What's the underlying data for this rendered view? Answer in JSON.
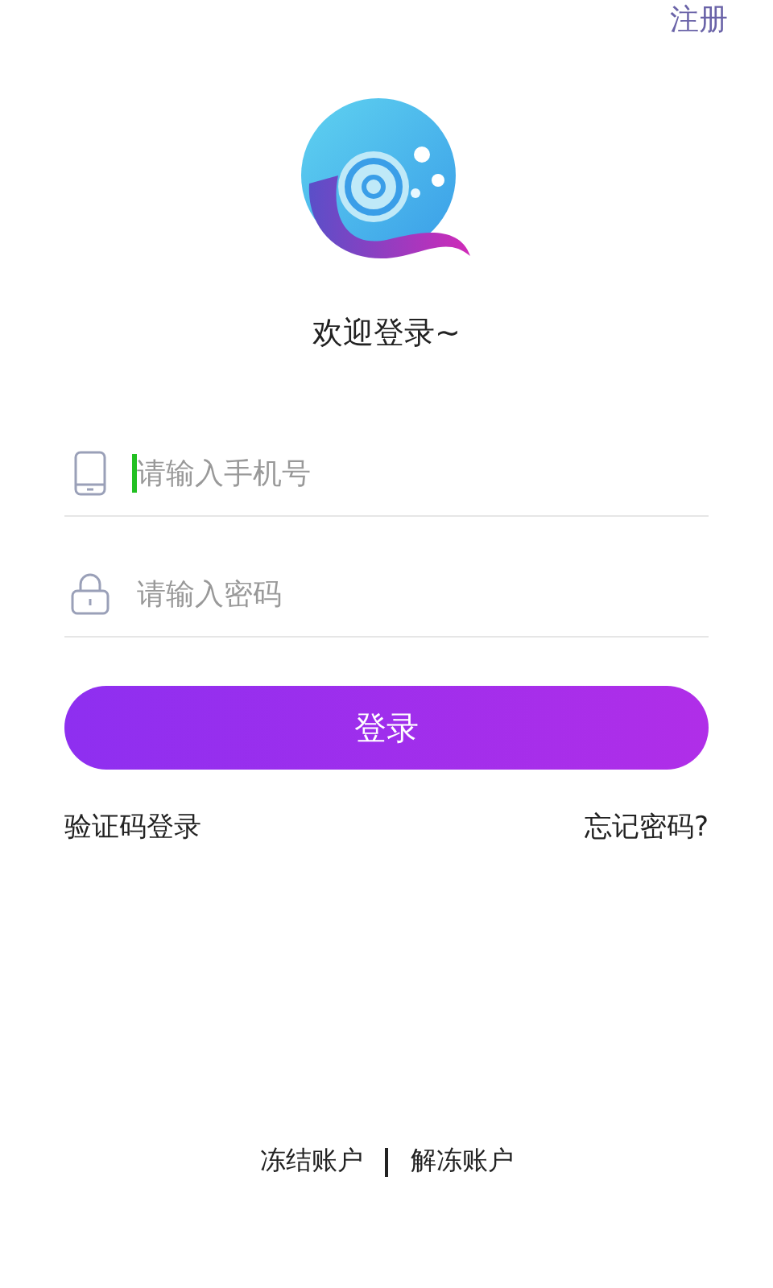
{
  "header": {
    "register_link": "注册"
  },
  "welcome": "欢迎登录~",
  "fields": [
    {
      "kind": "phone",
      "placeholder": "请输入手机号",
      "focused": true
    },
    {
      "kind": "password",
      "placeholder": "请输入密码",
      "focused": false
    }
  ],
  "login_button": "登录",
  "links": {
    "sms_login": "验证码登录",
    "forgot_password": "忘记密码?"
  },
  "footer": [
    {
      "label": "冻结账户"
    },
    {
      "label": "解冻账户"
    }
  ]
}
